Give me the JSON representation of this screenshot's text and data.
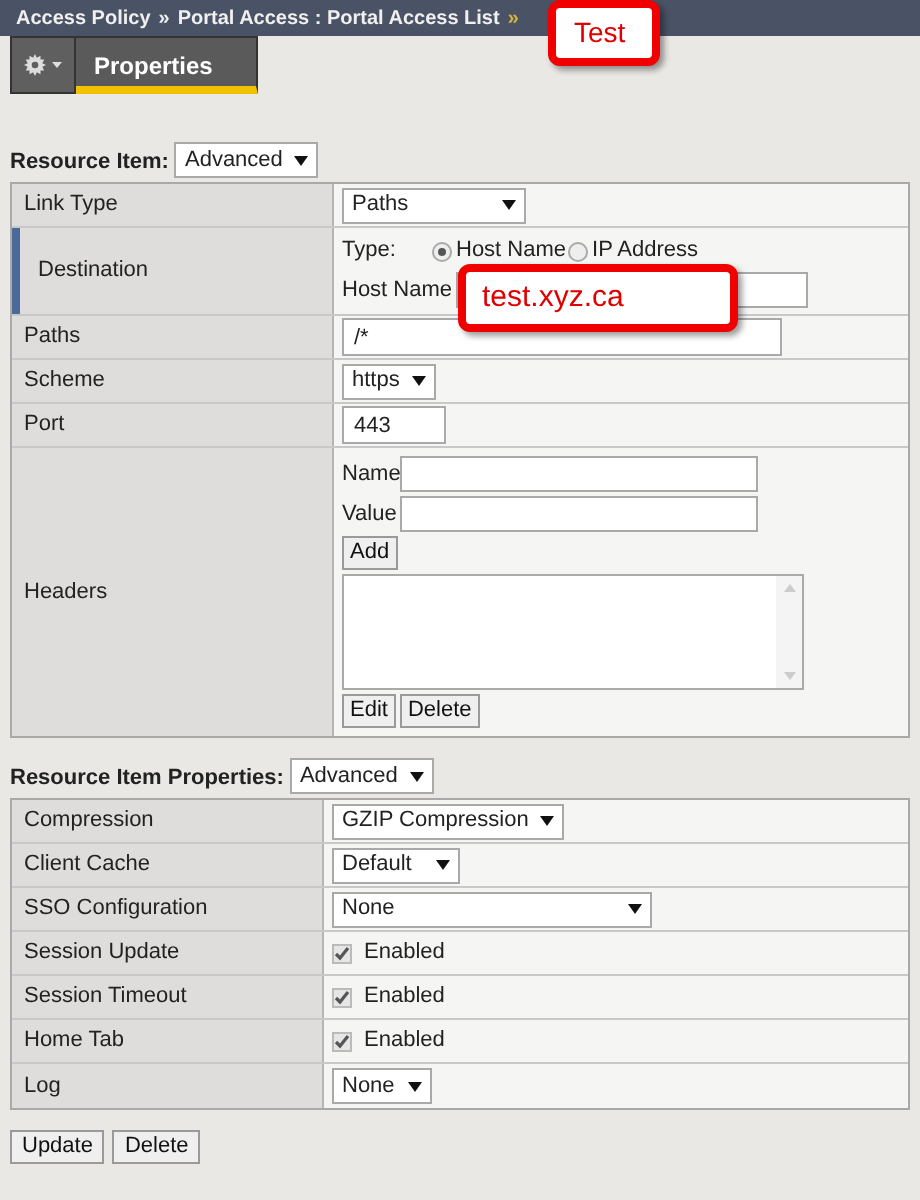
{
  "breadcrumb": {
    "items": [
      "Access Policy",
      "Portal Access : Portal Access List"
    ],
    "separator": "»",
    "callout": "Test"
  },
  "tabs": [
    {
      "label": "Properties",
      "selected": true
    }
  ],
  "resource_item": {
    "label": "Resource Item:",
    "mode": "Advanced",
    "rows": [
      {
        "kind": "select",
        "label": "Link Type",
        "value": "Paths"
      },
      {
        "kind": "destination",
        "label": "Destination",
        "type_label": "Type:",
        "options": [
          {
            "label": "Host Name",
            "selected": true
          },
          {
            "label": "IP Address",
            "selected": false
          }
        ],
        "host_label": "Host Name",
        "callout": "test.xyz.ca"
      },
      {
        "kind": "text",
        "label": "Paths",
        "value": "/*"
      },
      {
        "kind": "select",
        "label": "Scheme",
        "value": "https"
      },
      {
        "kind": "text",
        "label": "Port",
        "value": "443"
      },
      {
        "kind": "headers",
        "label": "Headers",
        "name_label": "Name",
        "value_label": "Value",
        "buttons": [
          "Add",
          "Edit",
          "Delete"
        ]
      }
    ]
  },
  "properties": {
    "label": "Resource Item Properties:",
    "mode": "Advanced",
    "rows": [
      {
        "kind": "select",
        "label": "Compression",
        "value": "GZIP Compression"
      },
      {
        "kind": "select",
        "label": "Client Cache",
        "value": "Default"
      },
      {
        "kind": "select",
        "label": "SSO Configuration",
        "value": "None"
      },
      {
        "kind": "checkbox",
        "label": "Session Update",
        "checked": true,
        "text": "Enabled"
      },
      {
        "kind": "checkbox",
        "label": "Session Timeout",
        "checked": true,
        "text": "Enabled"
      },
      {
        "kind": "checkbox",
        "label": "Home Tab",
        "checked": true,
        "text": "Enabled"
      },
      {
        "kind": "select",
        "label": "Log",
        "value": "None"
      }
    ]
  },
  "buttons": [
    "Update",
    "Delete"
  ]
}
